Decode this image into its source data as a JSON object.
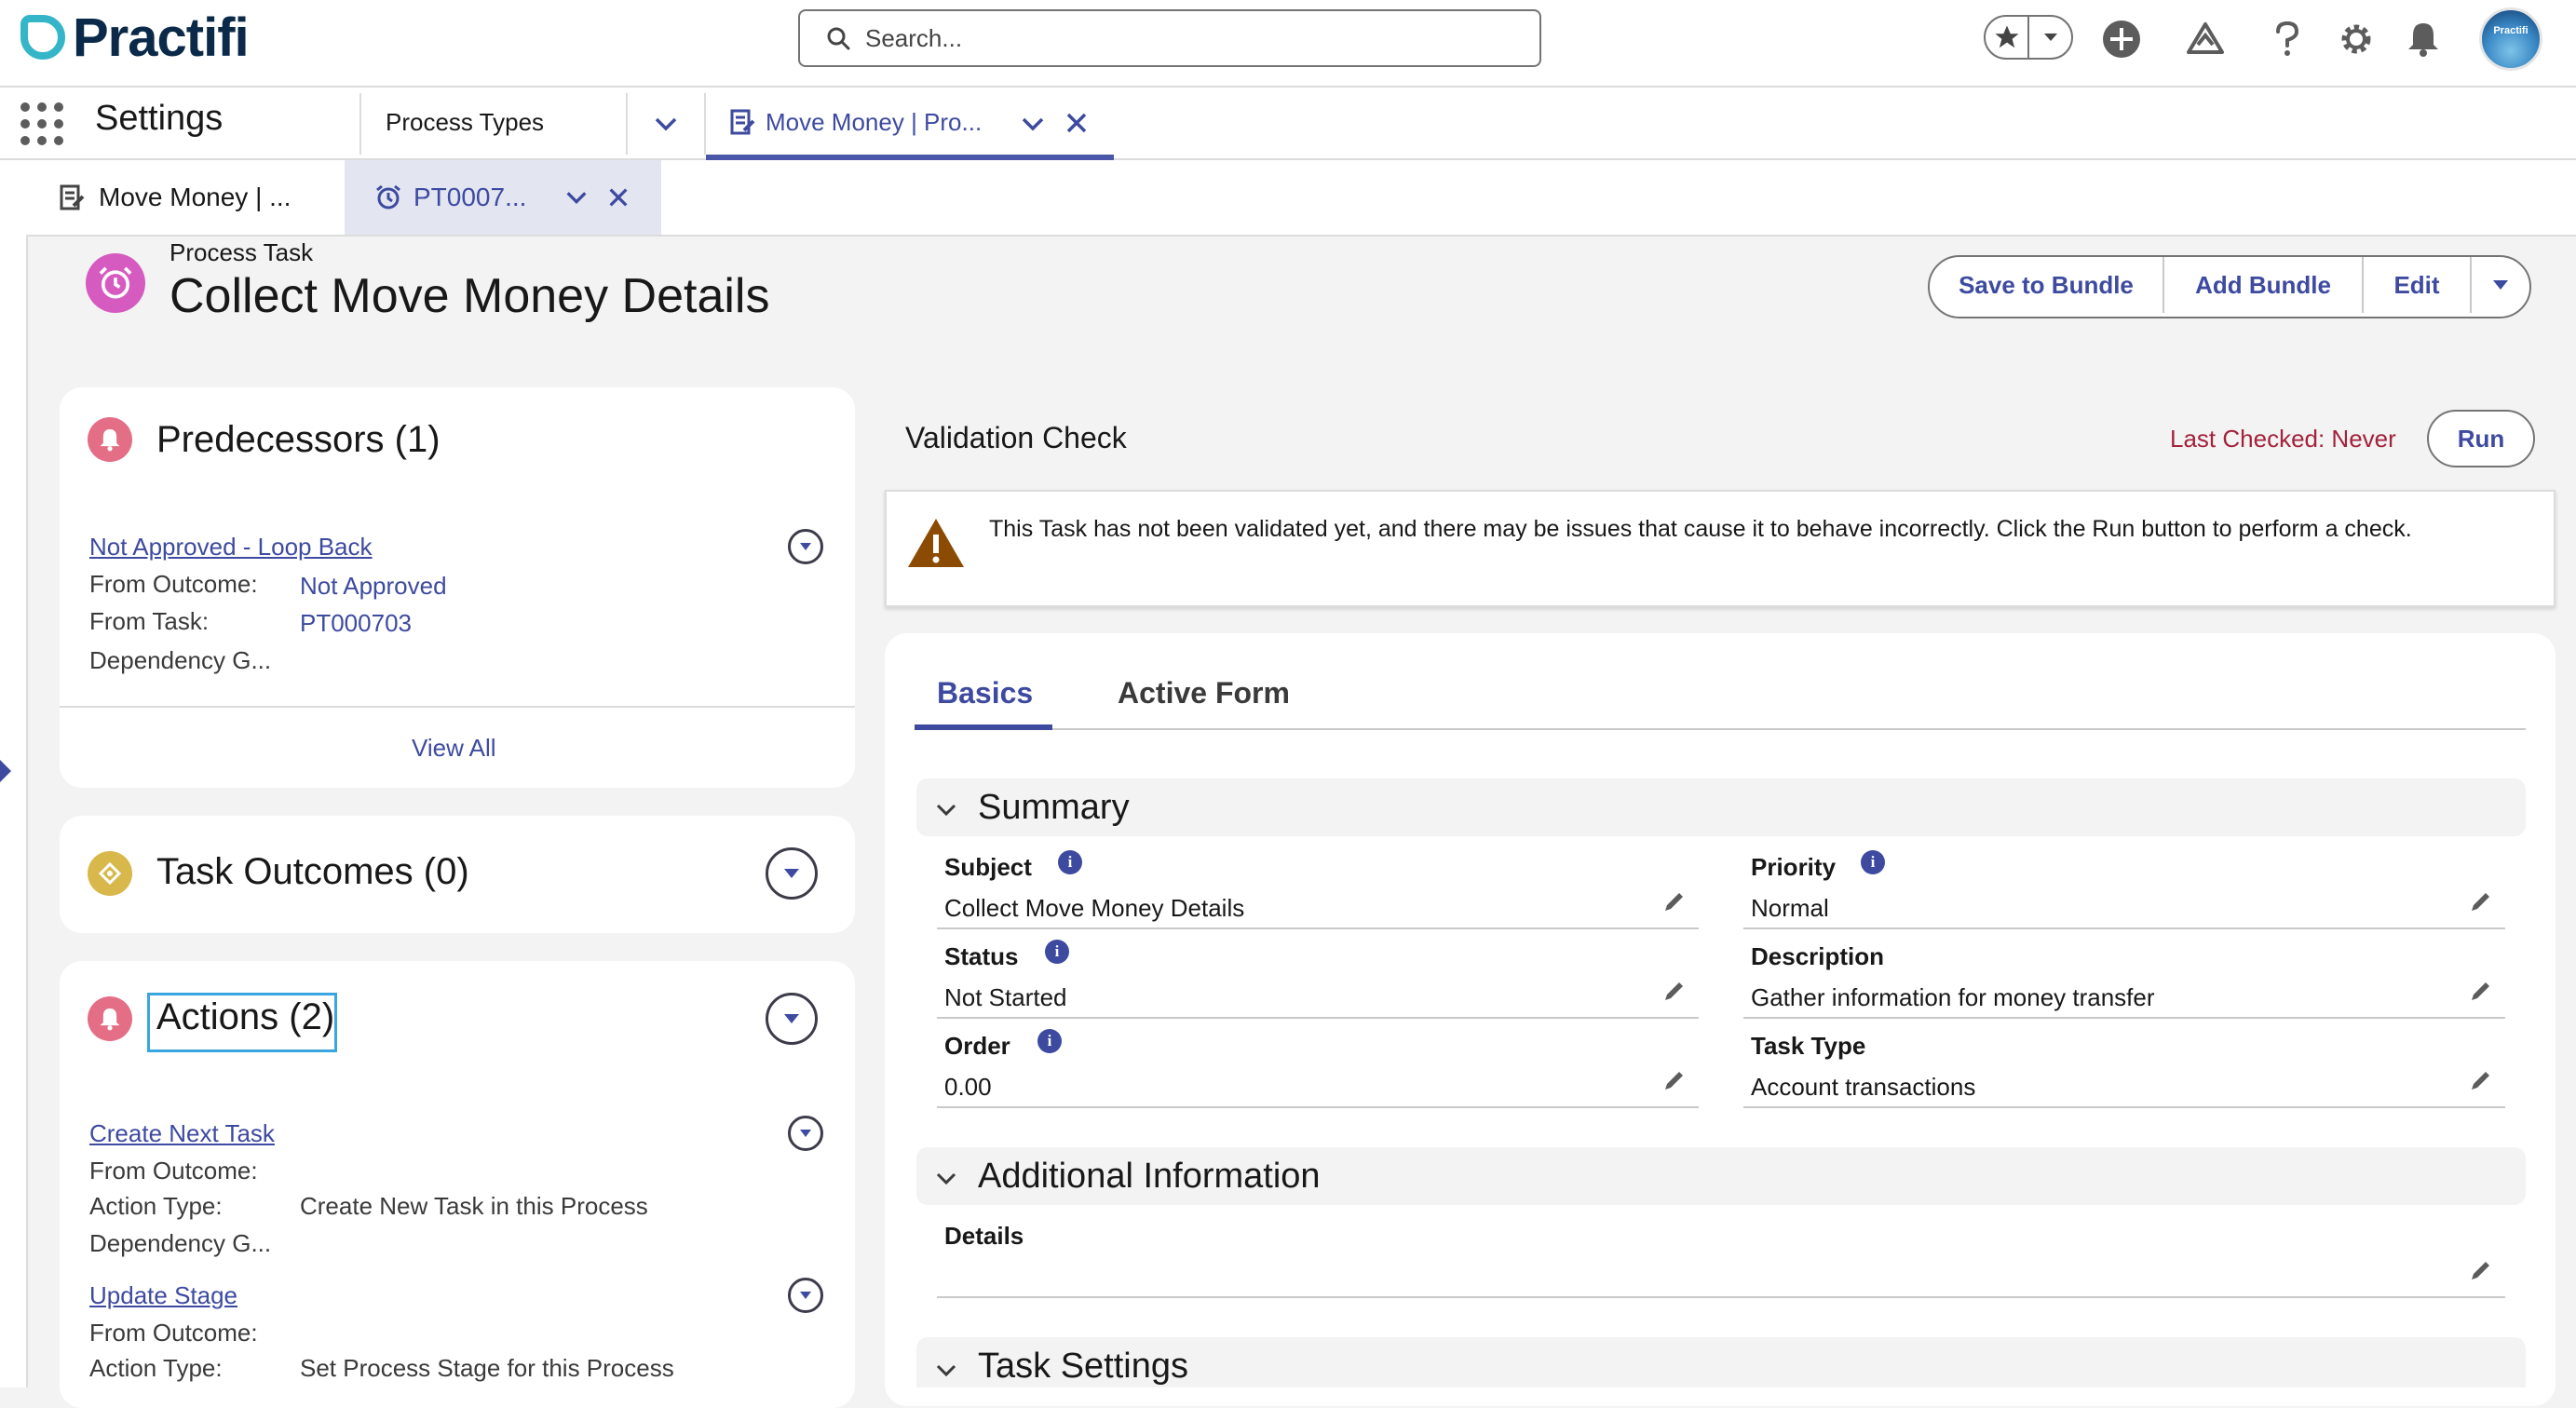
{
  "header": {
    "logo_text": "Practifi",
    "search_placeholder": "Search...",
    "avatar_text": "Practifi"
  },
  "nav": {
    "app_name": "Settings",
    "items": [
      {
        "label": "Process Types"
      },
      {
        "label": "Move Money | Pro..."
      }
    ]
  },
  "subtabs": [
    {
      "label": "Move Money | ..."
    },
    {
      "label": "PT0007..."
    }
  ],
  "record": {
    "type": "Process Task",
    "title": "Collect Move Money Details",
    "buttons": [
      "Save to Bundle",
      "Add Bundle",
      "Edit"
    ]
  },
  "predecessors": {
    "title": "Predecessors (1)",
    "item_link": "Not Approved - Loop Back",
    "from_outcome_label": "From Outcome:",
    "from_outcome_value": "Not Approved",
    "from_task_label": "From Task:",
    "from_task_value": "PT000703",
    "dependency_label": "Dependency G...",
    "view_all": "View All"
  },
  "task_outcomes": {
    "title": "Task Outcomes (0)"
  },
  "actions": {
    "title": "Actions (2)",
    "items": [
      {
        "link": "Create Next Task",
        "from_outcome_label": "From Outcome:",
        "action_type_label": "Action Type:",
        "action_type_value": "Create New Task in this Process",
        "dependency_label": "Dependency G..."
      },
      {
        "link": "Update Stage",
        "from_outcome_label": "From Outcome:",
        "action_type_label": "Action Type:",
        "action_type_value": "Set Process Stage for this Process"
      }
    ]
  },
  "validation": {
    "title": "Validation Check",
    "last_checked": "Last Checked: Never",
    "run_label": "Run",
    "warning": "This Task has not been validated yet, and there may be issues that cause it to behave incorrectly. Click the Run button to perform a check."
  },
  "detail": {
    "tabs": [
      "Basics",
      "Active Form"
    ],
    "summary_title": "Summary",
    "fields_left": [
      {
        "label": "Subject",
        "value": "Collect Move Money Details"
      },
      {
        "label": "Status",
        "value": "Not Started"
      },
      {
        "label": "Order",
        "value": "0.00"
      }
    ],
    "fields_right": [
      {
        "label": "Priority",
        "value": "Normal"
      },
      {
        "label": "Description",
        "value": "Gather information for money transfer"
      },
      {
        "label": "Task Type",
        "value": "Account transactions"
      }
    ],
    "additional_title": "Additional Information",
    "details_label": "Details",
    "details_value": "",
    "task_settings_title": "Task Settings"
  },
  "colors": {
    "brand": "#3d4aa0",
    "warning_red": "#a3223c",
    "record_icon": "#d55bc0",
    "bell": "#e46e85",
    "outcome_icon": "#d8b84a"
  }
}
